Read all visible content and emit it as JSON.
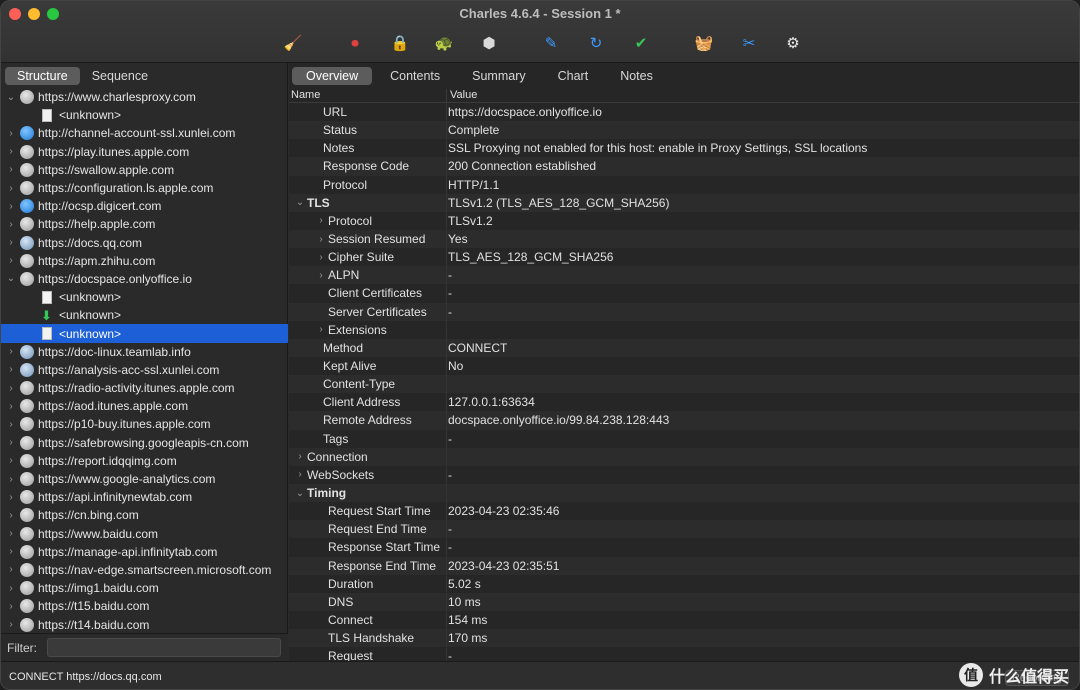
{
  "window": {
    "title": "Charles 4.6.4 - Session 1 *"
  },
  "toolbar": {
    "buttons": [
      {
        "name": "broom-icon",
        "glyph": "🧹",
        "color": "#e6b800"
      },
      {
        "name": "record-icon",
        "glyph": "⏺",
        "color": "#e04040"
      },
      {
        "name": "lock-icon",
        "glyph": "🔒",
        "color": "#d9d9d9"
      },
      {
        "name": "turtle-icon",
        "glyph": "🐢",
        "color": "#d9d9d9"
      },
      {
        "name": "stop-hexagon-icon",
        "glyph": "⬢",
        "color": "#d9d9d9"
      },
      {
        "name": "pen-icon",
        "glyph": "✎",
        "color": "#3a9bff"
      },
      {
        "name": "refresh-icon",
        "glyph": "↻",
        "color": "#3a9bff"
      },
      {
        "name": "checkmark-icon",
        "glyph": "✔",
        "color": "#3ac45a"
      },
      {
        "name": "basket-icon",
        "glyph": "🧺",
        "color": "#3ac45a"
      },
      {
        "name": "tools-icon",
        "glyph": "✂",
        "color": "#3a9bff"
      },
      {
        "name": "settings-gear-icon",
        "glyph": "⚙",
        "color": "#e8e8e8"
      }
    ]
  },
  "left": {
    "segments": [
      "Structure",
      "Sequence"
    ],
    "active_segment": "Structure",
    "tree": [
      {
        "type": "host",
        "label": "https://www.charlesproxy.com",
        "expanded": true,
        "icon": "gray"
      },
      {
        "type": "doc",
        "label": "<unknown>"
      },
      {
        "type": "host",
        "label": "http://channel-account-ssl.xunlei.com",
        "expanded": false,
        "icon": "blue"
      },
      {
        "type": "host",
        "label": "https://play.itunes.apple.com",
        "expanded": false,
        "icon": "gray"
      },
      {
        "type": "host",
        "label": "https://swallow.apple.com",
        "expanded": false,
        "icon": "gray"
      },
      {
        "type": "host",
        "label": "https://configuration.ls.apple.com",
        "expanded": false,
        "icon": "gray"
      },
      {
        "type": "host",
        "label": "http://ocsp.digicert.com",
        "expanded": false,
        "icon": "blue"
      },
      {
        "type": "host",
        "label": "https://help.apple.com",
        "expanded": false,
        "icon": "gray"
      },
      {
        "type": "host",
        "label": "https://docs.qq.com",
        "expanded": false,
        "icon": "bluegray"
      },
      {
        "type": "host",
        "label": "https://apm.zhihu.com",
        "expanded": false,
        "icon": "gray"
      },
      {
        "type": "host",
        "label": "https://docspace.onlyoffice.io",
        "expanded": true,
        "icon": "gray"
      },
      {
        "type": "doc",
        "label": "<unknown>"
      },
      {
        "type": "download",
        "label": "<unknown>"
      },
      {
        "type": "doc",
        "label": "<unknown>",
        "selected": true
      },
      {
        "type": "host",
        "label": "https://doc-linux.teamlab.info",
        "expanded": false,
        "icon": "bluegray"
      },
      {
        "type": "host",
        "label": "https://analysis-acc-ssl.xunlei.com",
        "expanded": false,
        "icon": "bluegray"
      },
      {
        "type": "host",
        "label": "https://radio-activity.itunes.apple.com",
        "expanded": false,
        "icon": "gray"
      },
      {
        "type": "host",
        "label": "https://aod.itunes.apple.com",
        "expanded": false,
        "icon": "gray"
      },
      {
        "type": "host",
        "label": "https://p10-buy.itunes.apple.com",
        "expanded": false,
        "icon": "gray"
      },
      {
        "type": "host",
        "label": "https://safebrowsing.googleapis-cn.com",
        "expanded": false,
        "icon": "gray"
      },
      {
        "type": "host",
        "label": "https://report.idqqimg.com",
        "expanded": false,
        "icon": "gray"
      },
      {
        "type": "host",
        "label": "https://www.google-analytics.com",
        "expanded": false,
        "icon": "gray"
      },
      {
        "type": "host",
        "label": "https://api.infinitynewtab.com",
        "expanded": false,
        "icon": "gray"
      },
      {
        "type": "host",
        "label": "https://cn.bing.com",
        "expanded": false,
        "icon": "gray"
      },
      {
        "type": "host",
        "label": "https://www.baidu.com",
        "expanded": false,
        "icon": "gray"
      },
      {
        "type": "host",
        "label": "https://manage-api.infinitytab.com",
        "expanded": false,
        "icon": "gray"
      },
      {
        "type": "host",
        "label": "https://nav-edge.smartscreen.microsoft.com",
        "expanded": false,
        "icon": "gray"
      },
      {
        "type": "host",
        "label": "https://img1.baidu.com",
        "expanded": false,
        "icon": "gray"
      },
      {
        "type": "host",
        "label": "https://t15.baidu.com",
        "expanded": false,
        "icon": "gray"
      },
      {
        "type": "host",
        "label": "https://t14.baidu.com",
        "expanded": false,
        "icon": "gray"
      }
    ],
    "filter_label": "Filter:",
    "filter_value": ""
  },
  "right": {
    "tabs": [
      "Overview",
      "Contents",
      "Summary",
      "Chart",
      "Notes"
    ],
    "active_tab": "Overview",
    "columns": {
      "name": "Name",
      "value": "Value"
    },
    "rows": [
      {
        "name": "URL",
        "value": "https://docspace.onlyoffice.io",
        "level": 1,
        "chevron": ""
      },
      {
        "name": "Status",
        "value": "Complete",
        "level": 1,
        "chevron": ""
      },
      {
        "name": "Notes",
        "value": "SSL Proxying not enabled for this host: enable in Proxy Settings, SSL locations",
        "level": 1,
        "chevron": ""
      },
      {
        "name": "Response Code",
        "value": "200 Connection established",
        "level": 1,
        "chevron": ""
      },
      {
        "name": "Protocol",
        "value": "HTTP/1.1",
        "level": 1,
        "chevron": ""
      },
      {
        "name": "TLS",
        "value": "TLSv1.2 (TLS_AES_128_GCM_SHA256)",
        "level": 0,
        "chevron": "down",
        "bold": true
      },
      {
        "name": "Protocol",
        "value": "TLSv1.2",
        "level": 2,
        "chevron": "right"
      },
      {
        "name": "Session Resumed",
        "value": "Yes",
        "level": 2,
        "chevron": "right"
      },
      {
        "name": "Cipher Suite",
        "value": "TLS_AES_128_GCM_SHA256",
        "level": 2,
        "chevron": "right"
      },
      {
        "name": "ALPN",
        "value": "-",
        "level": 2,
        "chevron": "right"
      },
      {
        "name": "Client Certificates",
        "value": "-",
        "level": 2,
        "chevron": ""
      },
      {
        "name": "Server Certificates",
        "value": "-",
        "level": 2,
        "chevron": ""
      },
      {
        "name": "Extensions",
        "value": "",
        "level": 2,
        "chevron": "right"
      },
      {
        "name": "Method",
        "value": "CONNECT",
        "level": 1,
        "chevron": ""
      },
      {
        "name": "Kept Alive",
        "value": "No",
        "level": 1,
        "chevron": ""
      },
      {
        "name": "Content-Type",
        "value": "",
        "level": 1,
        "chevron": ""
      },
      {
        "name": "Client Address",
        "value": "127.0.0.1:63634",
        "level": 1,
        "chevron": ""
      },
      {
        "name": "Remote Address",
        "value": "docspace.onlyoffice.io/99.84.238.128:443",
        "level": 1,
        "chevron": ""
      },
      {
        "name": "Tags",
        "value": "-",
        "level": 1,
        "chevron": ""
      },
      {
        "name": "Connection",
        "value": "",
        "level": 0,
        "chevron": "right"
      },
      {
        "name": "WebSockets",
        "value": "-",
        "level": 0,
        "chevron": "right"
      },
      {
        "name": "Timing",
        "value": "",
        "level": 0,
        "chevron": "down",
        "bold": true
      },
      {
        "name": "Request Start Time",
        "value": "2023-04-23 02:35:46",
        "level": 2,
        "chevron": ""
      },
      {
        "name": "Request End Time",
        "value": "-",
        "level": 2,
        "chevron": ""
      },
      {
        "name": "Response Start Time",
        "value": "-",
        "level": 2,
        "chevron": ""
      },
      {
        "name": "Response End Time",
        "value": "2023-04-23 02:35:51",
        "level": 2,
        "chevron": ""
      },
      {
        "name": "Duration",
        "value": "5.02 s",
        "level": 2,
        "chevron": ""
      },
      {
        "name": "DNS",
        "value": "10 ms",
        "level": 2,
        "chevron": ""
      },
      {
        "name": "Connect",
        "value": "154 ms",
        "level": 2,
        "chevron": ""
      },
      {
        "name": "TLS Handshake",
        "value": "170 ms",
        "level": 2,
        "chevron": ""
      },
      {
        "name": "Request",
        "value": "-",
        "level": 2,
        "chevron": ""
      }
    ]
  },
  "statusbar": {
    "text": "CONNECT https://docs.qq.com",
    "record_button": "Recording"
  },
  "watermark": {
    "logo": "值",
    "text": "什么值得买"
  }
}
